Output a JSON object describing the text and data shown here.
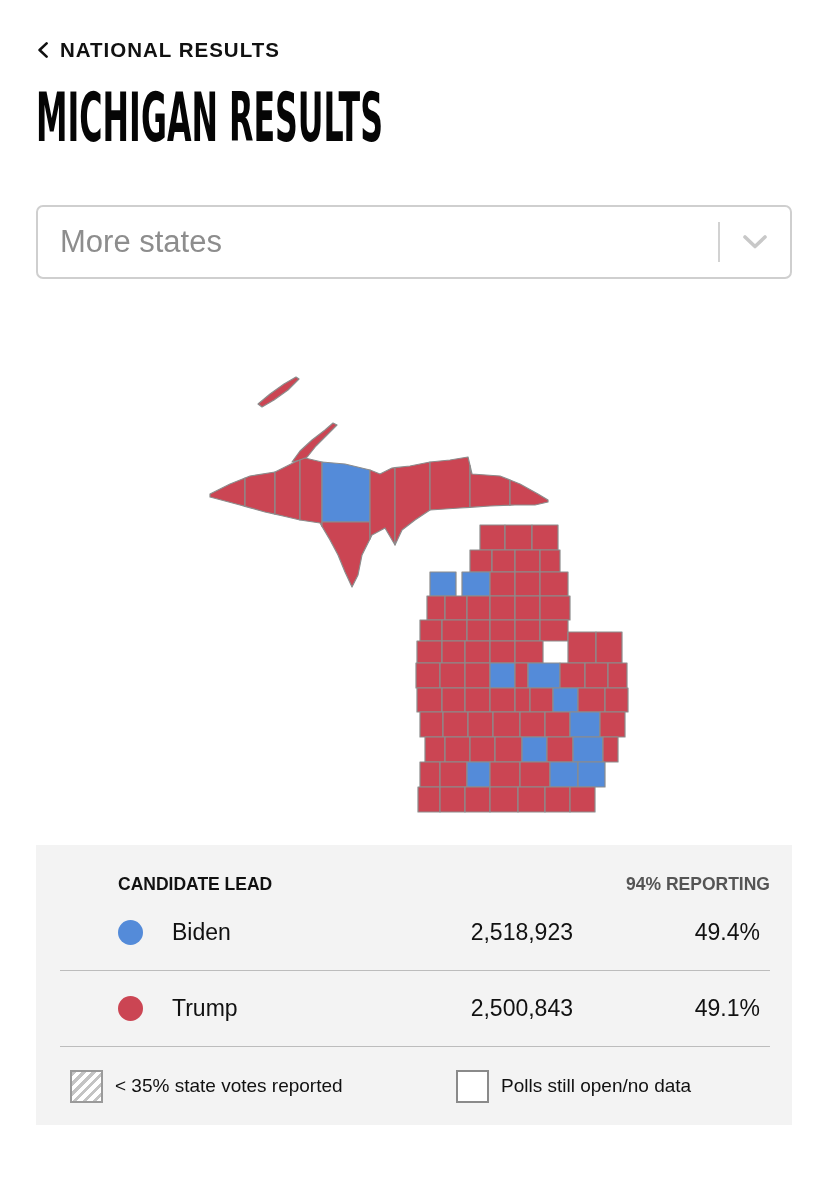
{
  "back_link": {
    "label": "NATIONAL RESULTS"
  },
  "title": "MICHIGAN RESULTS",
  "state_select": {
    "placeholder": "More states"
  },
  "map": {
    "counties": [
      {
        "color": "#cb4553"
      },
      {
        "color": "#cb4553"
      },
      {
        "color": "#cb4553"
      },
      {
        "color": "#cb4553"
      },
      {
        "color": "#cb4553"
      },
      {
        "color": "#cb4553"
      },
      {
        "color": "#548bd9"
      },
      {
        "color": "#cb4553"
      },
      {
        "color": "#cb4553"
      },
      {
        "color": "#cb4553"
      },
      {
        "color": "#cb4553"
      },
      {
        "color": "#cb4553"
      },
      {
        "color": "#cb4553"
      },
      {
        "color": "#cb4553"
      },
      {
        "color": "#cb4553"
      },
      {
        "color": "#cb4553"
      },
      {
        "color": "#cb4553"
      },
      {
        "color": "#cb4553"
      },
      {
        "color": "#cb4553"
      },
      {
        "color": "#cb4553"
      },
      {
        "color": "#548bd9"
      },
      {
        "color": "#548bd9"
      },
      {
        "color": "#cb4553"
      },
      {
        "color": "#cb4553"
      },
      {
        "color": "#cb4553"
      },
      {
        "color": "#cb4553"
      },
      {
        "color": "#cb4553"
      },
      {
        "color": "#cb4553"
      },
      {
        "color": "#cb4553"
      },
      {
        "color": "#cb4553"
      },
      {
        "color": "#cb4553"
      },
      {
        "color": "#cb4553"
      },
      {
        "color": "#cb4553"
      },
      {
        "color": "#cb4553"
      },
      {
        "color": "#cb4553"
      },
      {
        "color": "#cb4553"
      },
      {
        "color": "#cb4553"
      },
      {
        "color": "#cb4553"
      },
      {
        "color": "#cb4553"
      },
      {
        "color": "#cb4553"
      },
      {
        "color": "#cb4553"
      },
      {
        "color": "#cb4553"
      },
      {
        "color": "#cb4553"
      },
      {
        "color": "#cb4553"
      },
      {
        "color": "#cb4553"
      },
      {
        "color": "#cb4553"
      },
      {
        "color": "#cb4553"
      },
      {
        "color": "#548bd9"
      },
      {
        "color": "#cb4553"
      },
      {
        "color": "#548bd9"
      },
      {
        "color": "#cb4553"
      },
      {
        "color": "#cb4553"
      },
      {
        "color": "#cb4553"
      },
      {
        "color": "#cb4553"
      },
      {
        "color": "#cb4553"
      },
      {
        "color": "#cb4553"
      },
      {
        "color": "#cb4553"
      },
      {
        "color": "#cb4553"
      },
      {
        "color": "#cb4553"
      },
      {
        "color": "#548bd9"
      },
      {
        "color": "#cb4553"
      },
      {
        "color": "#cb4553"
      },
      {
        "color": "#cb4553"
      },
      {
        "color": "#cb4553"
      },
      {
        "color": "#cb4553"
      },
      {
        "color": "#cb4553"
      },
      {
        "color": "#cb4553"
      },
      {
        "color": "#cb4553"
      },
      {
        "color": "#548bd9"
      },
      {
        "color": "#cb4553"
      },
      {
        "color": "#cb4553"
      },
      {
        "color": "#cb4553"
      },
      {
        "color": "#cb4553"
      },
      {
        "color": "#cb4553"
      },
      {
        "color": "#548bd9"
      },
      {
        "color": "#cb4553"
      },
      {
        "color": "#548bd9"
      },
      {
        "color": "#cb4553"
      },
      {
        "color": "#cb4553"
      },
      {
        "color": "#cb4553"
      },
      {
        "color": "#548bd9"
      },
      {
        "color": "#cb4553"
      },
      {
        "color": "#cb4553"
      },
      {
        "color": "#548bd9"
      },
      {
        "color": "#548bd9"
      },
      {
        "color": "#cb4553"
      },
      {
        "color": "#cb4553"
      },
      {
        "color": "#cb4553"
      },
      {
        "color": "#cb4553"
      },
      {
        "color": "#cb4553"
      },
      {
        "color": "#cb4553"
      },
      {
        "color": "#cb4553"
      }
    ]
  },
  "results": {
    "heading": "CANDIDATE LEAD",
    "reporting": "94% REPORTING",
    "candidates": [
      {
        "name": "Biden",
        "votes": "2,518,923",
        "percent": "49.4%",
        "color": "#548bd9"
      },
      {
        "name": "Trump",
        "votes": "2,500,843",
        "percent": "49.1%",
        "color": "#cb4553"
      }
    ]
  },
  "legend": [
    {
      "kind": "hatched",
      "label": "< 35% state votes reported"
    },
    {
      "kind": "empty",
      "label": "Polls still open/no data"
    }
  ]
}
